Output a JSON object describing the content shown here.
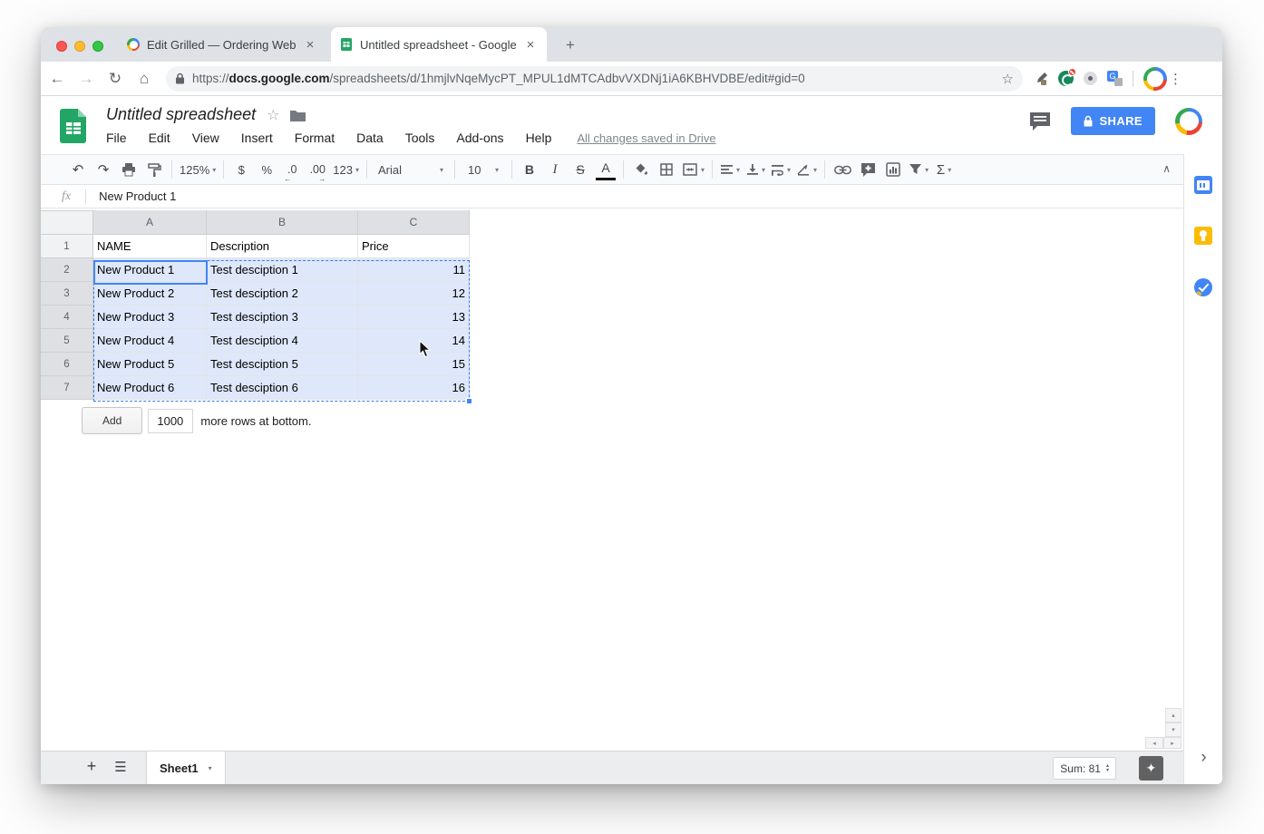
{
  "browser": {
    "tabs": [
      {
        "title": "Edit Grilled — Ordering Web &"
      },
      {
        "title": "Untitled spreadsheet - Google"
      }
    ],
    "url_protocol": "https://",
    "url_host": "docs.google.com",
    "url_path": "/spreadsheets/d/1hmjlvNqeMycPT_MPUL1dMTCAdbvVXDNj1iA6KBHVDBE/edit#gid=0"
  },
  "header": {
    "title": "Untitled spreadsheet",
    "menus": [
      "File",
      "Edit",
      "View",
      "Insert",
      "Format",
      "Data",
      "Tools",
      "Add-ons",
      "Help"
    ],
    "saved_status": "All changes saved in Drive",
    "share_label": "SHARE"
  },
  "toolbar": {
    "zoom": "125%",
    "currency": "$",
    "percent": "%",
    "decimal_decrease": ".0",
    "decimal_increase": ".00",
    "more_formats": "123",
    "font": "Arial",
    "font_size": "10",
    "bold": "B",
    "italic": "I",
    "strikethrough": "S",
    "text_color": "A",
    "functions": "Σ"
  },
  "formula_bar": {
    "label": "fx",
    "value": "New Product 1"
  },
  "grid": {
    "column_headers": [
      "A",
      "B",
      "C"
    ],
    "rows": [
      {
        "num": "1",
        "cells": [
          "NAME",
          "Description",
          "Price"
        ],
        "selected": false
      },
      {
        "num": "2",
        "cells": [
          "New Product 1",
          "Test desciption 1",
          "11"
        ],
        "selected": true
      },
      {
        "num": "3",
        "cells": [
          "New Product 2",
          "Test desciption 2",
          "12"
        ],
        "selected": true
      },
      {
        "num": "4",
        "cells": [
          "New Product 3",
          "Test desciption 3",
          "13"
        ],
        "selected": true
      },
      {
        "num": "5",
        "cells": [
          "New Product 4",
          "Test desciption 4",
          "14"
        ],
        "selected": true
      },
      {
        "num": "6",
        "cells": [
          "New Product 5",
          "Test desciption 5",
          "15"
        ],
        "selected": true
      },
      {
        "num": "7",
        "cells": [
          "New Product 6",
          "Test desciption 6",
          "16"
        ],
        "selected": true
      }
    ],
    "selection": {
      "range": "A2:C7",
      "active_cell": "A2"
    }
  },
  "add_rows": {
    "button_label": "Add",
    "count_value": "1000",
    "suffix_text": "more rows at bottom."
  },
  "bottom_bar": {
    "sheet_tab": "Sheet1",
    "sum_label": "Sum: 81"
  },
  "icons": {
    "close": "×",
    "new_tab": "+",
    "back": "←",
    "forward": "→",
    "reload": "↻",
    "home": "⌂",
    "bookmark_star": "☆",
    "overflow": "⋮",
    "undo": "↶",
    "redo": "↷",
    "dropdown": "▾",
    "collapse": "∧",
    "title_star": "☆",
    "add_sheet": "+",
    "all_sheets": "☰",
    "explore": "✦",
    "panel_chevron": "›",
    "scroll_up": "▴",
    "scroll_down": "▾",
    "scroll_left": "◂",
    "scroll_right": "▸",
    "decimal_left_arrow": "←",
    "decimal_right_arrow": "→",
    "translate_letter": "G"
  },
  "colors": {
    "accent_blue": "#4285F4",
    "sheets_green": "#23A566",
    "selection_fill": "#DEE8FA",
    "share_button": "#4285F4"
  }
}
